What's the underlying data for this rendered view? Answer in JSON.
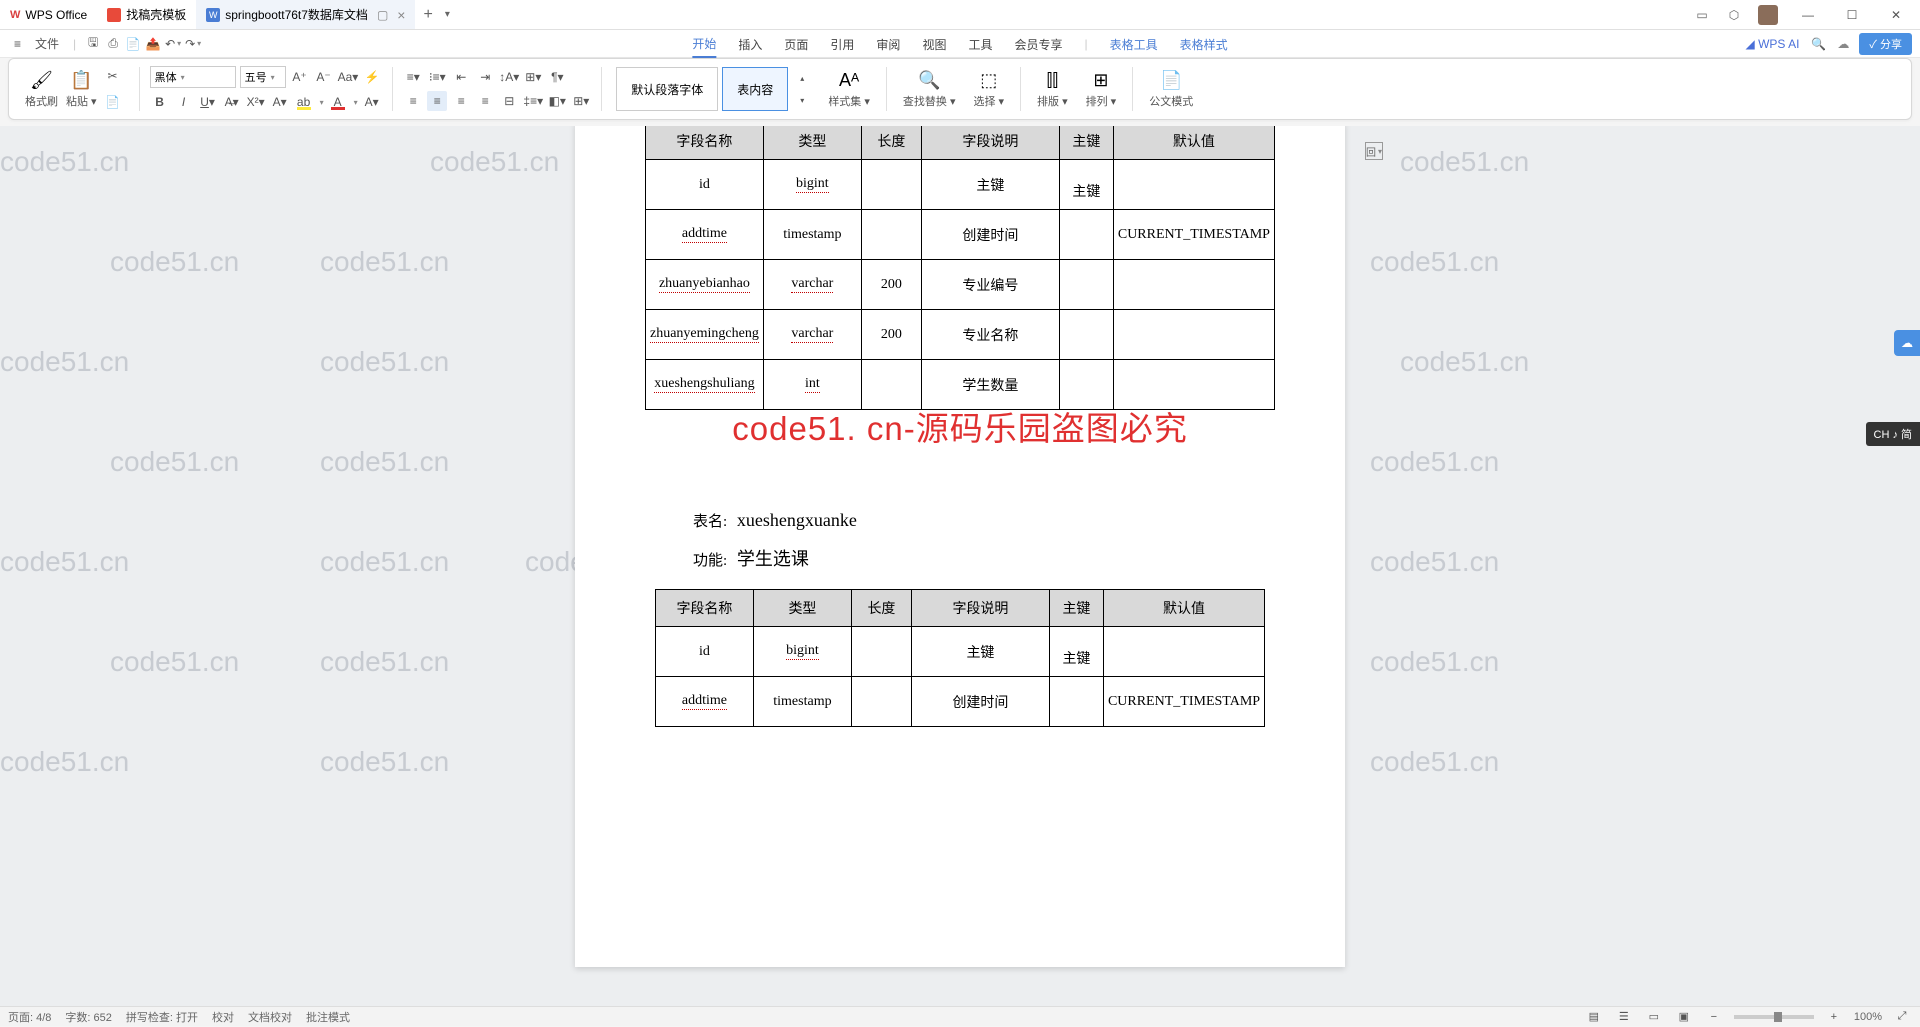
{
  "app": {
    "name": "WPS Office"
  },
  "tabs": [
    {
      "icon": "red",
      "label": "找稿壳模板"
    },
    {
      "icon": "blue",
      "iconLetter": "W",
      "label": "springboott76t7数据库文档",
      "active": true,
      "closable": true
    }
  ],
  "menubar": {
    "fileMenu": "文件"
  },
  "ribbonTabs": [
    "开始",
    "插入",
    "页面",
    "引用",
    "审阅",
    "视图",
    "工具",
    "会员专享"
  ],
  "ribbonToolTabs": [
    "表格工具",
    "表格样式"
  ],
  "ribbonActiveTab": "开始",
  "wpsAi": "WPS AI",
  "shareLabel": "分享",
  "ribbon": {
    "formatBrush": "格式刷",
    "paste": "粘贴",
    "fontName": "黑体",
    "fontSize": "五号",
    "styleDefault": "默认段落字体",
    "styleContent": "表内容",
    "styleSet": "样式集",
    "findReplace": "查找替换",
    "select": "选择",
    "layout": "排版",
    "arrange": "排列",
    "officialMode": "公文模式"
  },
  "document": {
    "watermark": "code51.cn",
    "overlay": "code51. cn-源码乐园盗图必究",
    "paperRightMark": "回",
    "table1": {
      "headers": [
        "字段名称",
        "类型",
        "长度",
        "字段说明",
        "主键",
        "默认值"
      ],
      "rows": [
        {
          "name": "id",
          "type": "bigint",
          "len": "",
          "desc": "主键",
          "pk": "主键",
          "def": ""
        },
        {
          "name": "addtime",
          "type": "timestamp",
          "len": "",
          "desc": "创建时间",
          "pk": "",
          "def": "CURRENT_TIMESTAMP"
        },
        {
          "name": "zhuanyebianhao",
          "type": "varchar",
          "len": "200",
          "desc": "专业编号",
          "pk": "",
          "def": ""
        },
        {
          "name": "zhuanyemingcheng",
          "type": "varchar",
          "len": "200",
          "desc": "专业名称",
          "pk": "",
          "def": ""
        },
        {
          "name": "xueshengshuliang",
          "type": "int",
          "len": "",
          "desc": "学生数量",
          "pk": "",
          "def": ""
        }
      ]
    },
    "section2": {
      "nameLabel": "表名:",
      "nameValue": "xueshengxuanke",
      "funcLabel": "功能:",
      "funcValue": "学生选课"
    },
    "table2": {
      "headers": [
        "字段名称",
        "类型",
        "长度",
        "字段说明",
        "主键",
        "默认值"
      ],
      "rows": [
        {
          "name": "id",
          "type": "bigint",
          "len": "",
          "desc": "主键",
          "pk": "主键",
          "def": ""
        },
        {
          "name": "addtime",
          "type": "timestamp",
          "len": "",
          "desc": "创建时间",
          "pk": "",
          "def": "CURRENT_TIMESTAMP"
        }
      ]
    }
  },
  "statusbar": {
    "page": "页面: 4/8",
    "words": "字数: 652",
    "spell": "拼写检查: 打开",
    "proof": "校对",
    "doccheck": "文档校对",
    "comments": "批注模式",
    "zoom": "100%"
  },
  "ime": "CH ♪ 简"
}
